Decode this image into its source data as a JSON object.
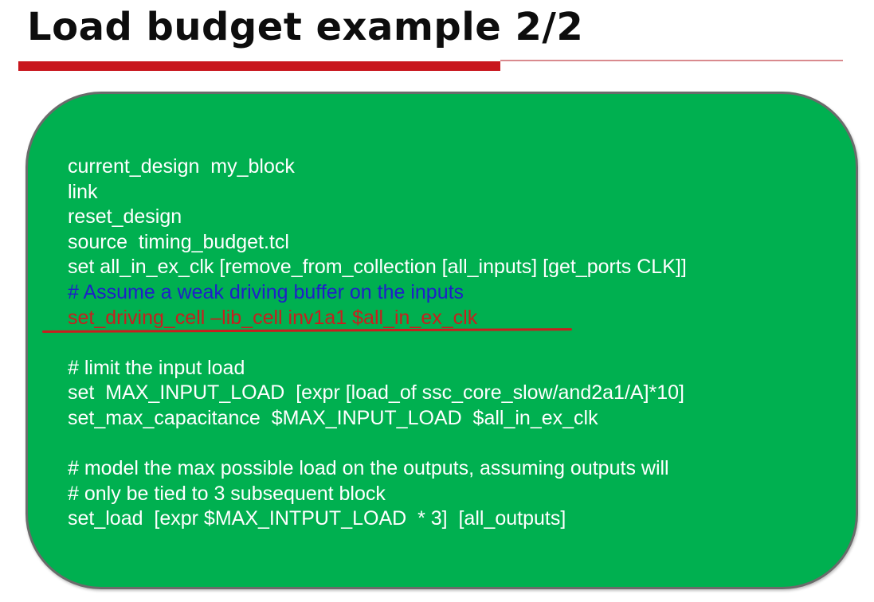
{
  "slide": {
    "title": "Load budget example 2/2",
    "colors": {
      "title": "#0d0d0d",
      "rule_accent": "#c8161d",
      "box_fill": "#00b050",
      "box_border": "#6b6b6b",
      "code_text": "#ffffff",
      "comment_blue": "#1f1fc9",
      "annotation_red": "#c81e1e"
    }
  },
  "code": {
    "lines": [
      "current_design  my_block",
      "link",
      "reset_design",
      "source  timing_budget.tcl",
      "set all_in_ex_clk [remove_from_collection [all_inputs] [get_ports CLK]]",
      "# Assume a weak driving buffer on the inputs",
      "set_driving_cell –lib_cell inv1a1 $all_in_ex_clk",
      "",
      "# limit the input load",
      "set  MAX_INPUT_LOAD  [expr [load_of ssc_core_slow/and2a1/A]*10]",
      "set_max_capacitance  $MAX_INPUT_LOAD  $all_in_ex_clk",
      "",
      "# model the max possible load on the outputs, assuming outputs will",
      "# only be tied to 3 subsequent block",
      "set_load  [expr $MAX_INTPUT_LOAD  * 3]  [all_outputs]"
    ]
  }
}
